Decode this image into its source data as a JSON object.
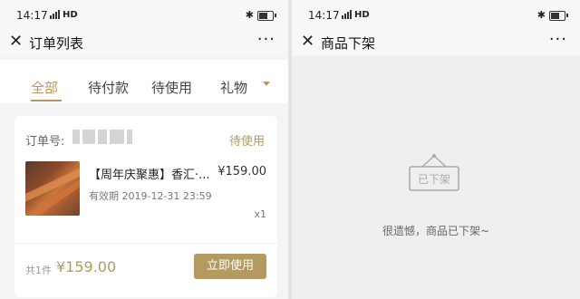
{
  "left_screen": {
    "statusbar": {
      "time": "14:17",
      "network": "HD"
    },
    "titlebar": {
      "title": "订单列表",
      "more": "···"
    },
    "tabs": [
      "全部",
      "待付款",
      "待使用",
      "礼物"
    ],
    "active_tab": "全部",
    "order": {
      "order_no_label": "订单号:",
      "status": "待使用",
      "product_name": "【周年庆聚惠】香汇·...",
      "price": "¥159.00",
      "valid_until": "有效期 2019-12-31 23:59",
      "quantity": "x1",
      "total_label": "共1件",
      "total_price": "¥159.00",
      "action_button": "立即使用"
    }
  },
  "right_screen": {
    "statusbar": {
      "time": "14:17",
      "network": "HD"
    },
    "titlebar": {
      "title": "商品下架",
      "more": "···"
    },
    "empty_state": {
      "icon_label": "已下架",
      "message": "很遗憾，商品已下架~"
    }
  },
  "colors": {
    "accent": "#b49a5e",
    "background": "#f4f4f4"
  }
}
